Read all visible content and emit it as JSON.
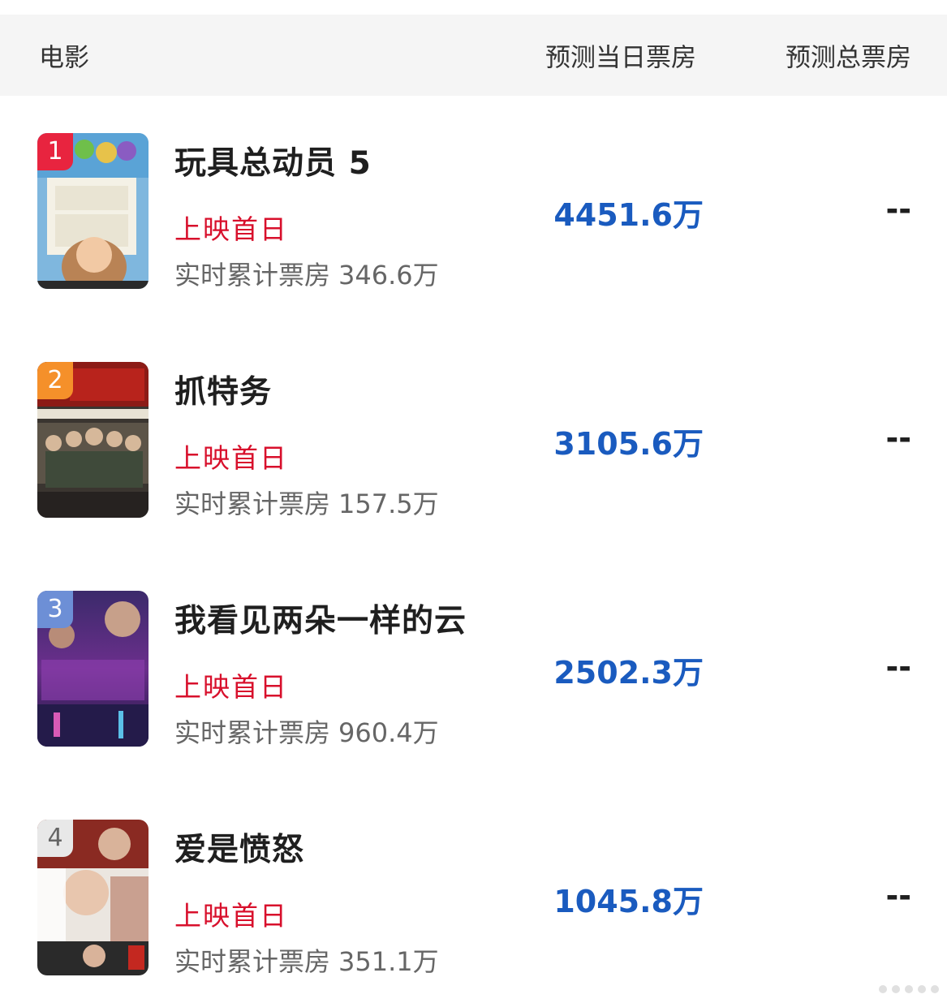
{
  "header": {
    "movie": "电影",
    "today_forecast": "预测当日票房",
    "total_forecast": "预测总票房"
  },
  "colors": {
    "status_red": "#d8102c",
    "forecast_blue": "#1a5bbf",
    "header_bg": "#f5f5f5"
  },
  "movies": [
    {
      "rank": "1",
      "rank_color": "#e8243f",
      "title": "玩具总动员 5",
      "status": "上映首日",
      "cumulative_label": "实时累计票房",
      "cumulative_value": "346.6万",
      "today_forecast": "4451.6万",
      "total_forecast": "--"
    },
    {
      "rank": "2",
      "rank_color": "#f5902a",
      "title": "抓特务",
      "status": "上映首日",
      "cumulative_label": "实时累计票房",
      "cumulative_value": "157.5万",
      "today_forecast": "3105.6万",
      "total_forecast": "--"
    },
    {
      "rank": "3",
      "rank_color": "#6d8fd6",
      "title": "我看见两朵一样的云",
      "status": "上映首日",
      "cumulative_label": "实时累计票房",
      "cumulative_value": "960.4万",
      "today_forecast": "2502.3万",
      "total_forecast": "--"
    },
    {
      "rank": "4",
      "rank_color": "#9a9a9a",
      "title": "爱是愤怒",
      "status": "上映首日",
      "cumulative_label": "实时累计票房",
      "cumulative_value": "351.1万",
      "today_forecast": "1045.8万",
      "total_forecast": "--"
    }
  ]
}
